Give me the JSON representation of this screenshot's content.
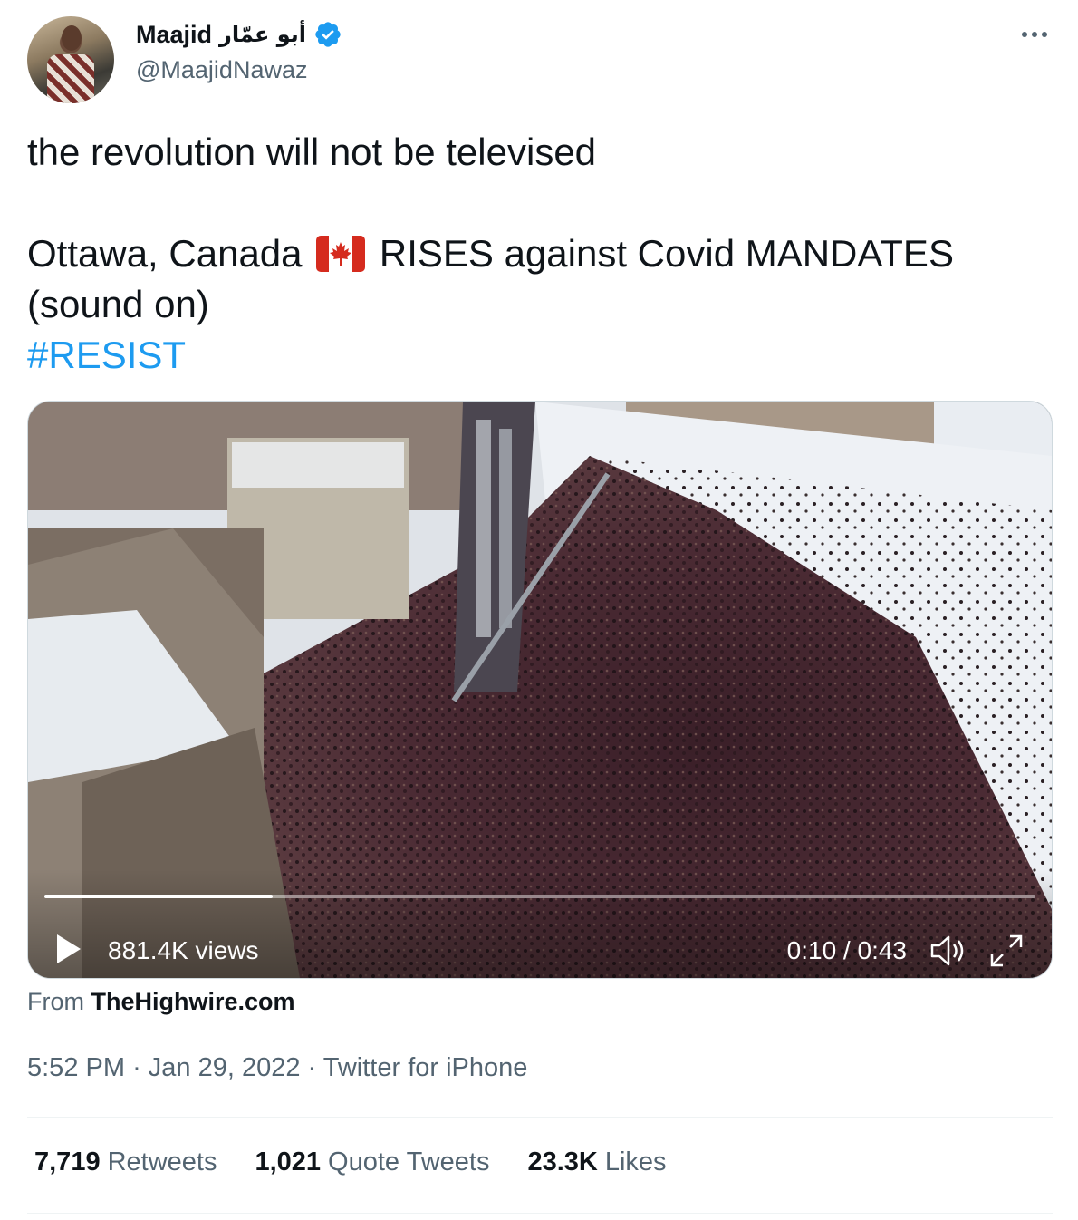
{
  "user": {
    "display_name": "Maajid",
    "arabic_name": "أبو عمّار",
    "handle": "@MaajidNawaz",
    "verified_color": "#1d9bf0"
  },
  "tweet": {
    "line1": "the revolution will not be televised",
    "line2_before_flag": "Ottawa, Canada",
    "flag_icon": "canada-flag-icon",
    "line2_after_flag": "RISES against Covid MANDATES",
    "line3": "(sound on)",
    "hashtag": "#RESIST",
    "hashtag_color": "#1d9bf0"
  },
  "video": {
    "views": "881.4K views",
    "time": "0:10 / 0:43",
    "progress": 0.23,
    "play_icon": "play-icon",
    "volume_icon": "volume-icon",
    "fullscreen_icon": "fullscreen-icon"
  },
  "source": {
    "prefix": "From",
    "name": "TheHighwire.com"
  },
  "meta": {
    "time": "5:52 PM",
    "date": "Jan 29, 2022",
    "client": "Twitter for iPhone"
  },
  "stats": {
    "retweets_count": "7,719",
    "retweets_label": "Retweets",
    "quotes_count": "1,021",
    "quotes_label": "Quote Tweets",
    "likes_count": "23.3K",
    "likes_label": "Likes"
  }
}
